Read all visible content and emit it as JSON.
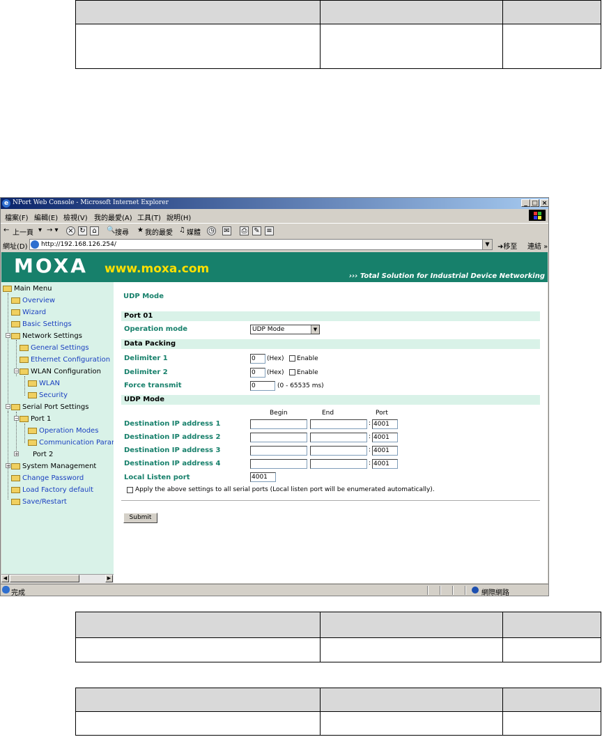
{
  "window": {
    "title": "NPort Web Console - Microsoft Internet Explorer",
    "min": "_",
    "max": "□",
    "close": "×"
  },
  "menu": [
    "檔案(F)",
    "編輯(E)",
    "檢視(V)",
    "我的最愛(A)",
    "工具(T)",
    "說明(H)"
  ],
  "toolbar": {
    "back": "上一頁",
    "search": "搜尋",
    "favorites": "我的最愛",
    "media": "媒體"
  },
  "address": {
    "label": "網址(D)",
    "url": "http://192.168.126.254/",
    "go": "移至",
    "links": "連結"
  },
  "banner": {
    "logo": "MOXA",
    "url": "www.moxa.com",
    "tagline": "Total Solution for Industrial Device Networking"
  },
  "tree": {
    "main_menu": "Main Menu",
    "overview": "Overview",
    "wizard": "Wizard",
    "basic_settings": "Basic Settings",
    "network_settings": "Network Settings",
    "general_settings": "General Settings",
    "ethernet_configuration": "Ethernet Configuration",
    "wlan_configuration": "WLAN Configuration",
    "wlan": "WLAN",
    "security": "Security",
    "serial_port_settings": "Serial Port Settings",
    "port1": "Port 1",
    "operation_modes": "Operation Modes",
    "communication_params": "Communication Paran",
    "port2": "Port 2",
    "system_management": "System Management",
    "change_password": "Change Password",
    "load_factory_default": "Load Factory default",
    "save_restart": "Save/Restart"
  },
  "form": {
    "heading": "UDP Mode",
    "port_section": "Port 01",
    "operation_mode_label": "Operation mode",
    "operation_mode_value": "UDP Mode",
    "data_packing_section": "Data Packing",
    "delimiter1_label": "Delimiter 1",
    "delimiter1_value": "0",
    "delimiter2_label": "Delimiter 2",
    "delimiter2_value": "0",
    "hex": "(Hex)",
    "enable": "Enable",
    "force_transmit_label": "Force transmit",
    "force_transmit_value": "0",
    "force_transmit_range": "(0 - 65535 ms)",
    "udp_section": "UDP Mode",
    "col_begin": "Begin",
    "col_end": "End",
    "col_port": "Port",
    "destinations": [
      {
        "label": "Destination IP address 1",
        "begin": "",
        "end": "",
        "port": "4001"
      },
      {
        "label": "Destination IP address 2",
        "begin": "",
        "end": "",
        "port": "4001"
      },
      {
        "label": "Destination IP address 3",
        "begin": "",
        "end": "",
        "port": "4001"
      },
      {
        "label": "Destination IP address 4",
        "begin": "",
        "end": "",
        "port": "4001"
      }
    ],
    "colon": ":",
    "local_listen_label": "Local Listen port",
    "local_listen_value": "4001",
    "apply_all": "Apply the above settings to all serial ports (Local listen port will be enumerated automatically).",
    "submit": "Submit"
  },
  "status": {
    "done": "完成",
    "zone": "網際網路"
  }
}
